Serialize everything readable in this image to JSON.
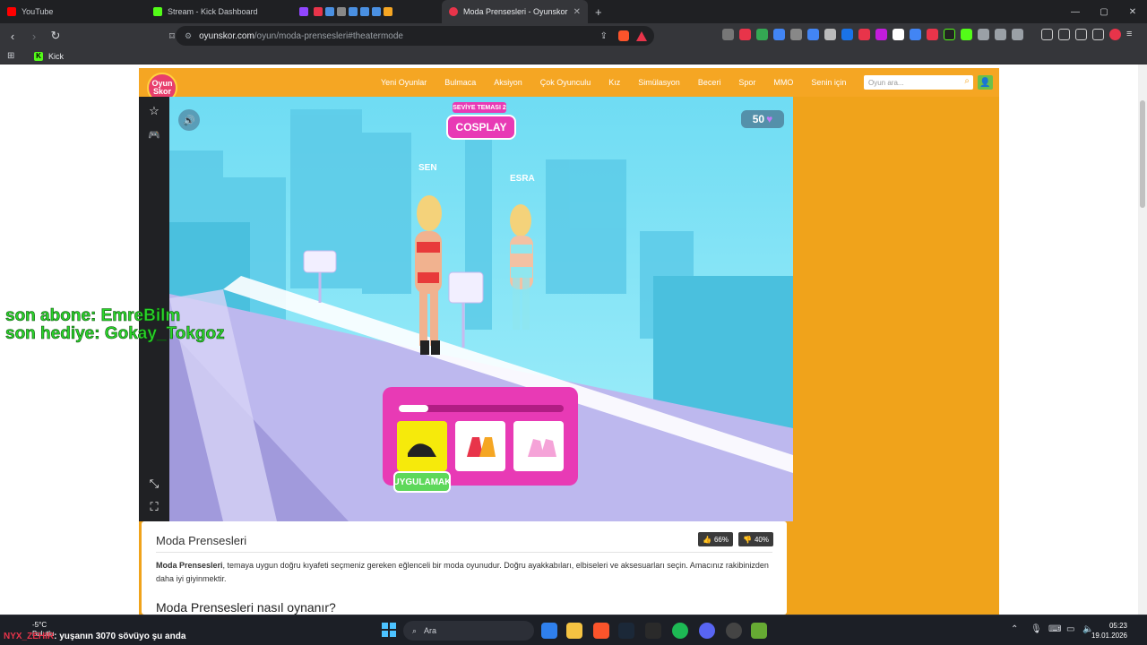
{
  "browser": {
    "tabs": [
      {
        "label": "YouTube",
        "color": "#ff0000"
      },
      {
        "label": "Stream - Kick Dashboard",
        "color": "#53fc18"
      },
      {
        "label": "",
        "color": "#9146ff"
      },
      {
        "label": "Moda Prensesleri - Oyunskor",
        "color": "#e8344a",
        "active": true
      }
    ],
    "new_tab": "+",
    "url_site": "oyunskor.com",
    "url_path": "/oyun/moda-prensesleri#theatermode",
    "bookmark": "Kick",
    "win_min": "—",
    "win_max": "▢",
    "win_close": "✕"
  },
  "site": {
    "logo_line1": "Oyun",
    "logo_line2": "Skor",
    "menu": [
      "Yeni Oyunlar",
      "Bulmaca",
      "Aksiyon",
      "Çok Oyunculu",
      "Kız",
      "Simülasyon",
      "Beceri",
      "Spor",
      "MMO",
      "Senin için"
    ],
    "search_placeholder": "Oyun ara...",
    "search_icon": "⌕",
    "user_icon": "👤"
  },
  "game": {
    "level_label": "SEVİYE TEMASI 2",
    "theme": "COSPLAY",
    "player_label": "SEN",
    "rival_label": "ESRA",
    "gems": "50",
    "gem_icon": "♥",
    "sound_icon": "🔊",
    "apply_button": "UYGULAMAK",
    "progress": 0.18,
    "colors": {
      "pink": "#e83ab5",
      "gold": "#f5a623",
      "green": "#5ed85a",
      "sky": "#7fe7f6"
    }
  },
  "rail": {
    "star_icon": "☆",
    "gamepad_icon": "🎮",
    "shrink_icon": "⤡",
    "fullscreen_icon": "⛶"
  },
  "info": {
    "title": "Moda Prensesleri",
    "likes": "66%",
    "dislikes": "40%",
    "like_icon": "👍",
    "dislike_icon": "👎",
    "desc_bold": "Moda Prensesleri",
    "desc_rest": ", temaya uygun doğru kıyafeti seçmeniz gereken eğlenceli bir moda oyunudur. Doğru ayakkabıları, elbiseleri ve aksesuarları seçin. Amacınız rakibinizden daha iyi giyinmektir.",
    "howto": "Moda Prensesleri nasıl oynanır?"
  },
  "overlay": {
    "line1": "son abone: EmreBilm",
    "line2": "son hediye: Gokay_Tokgoz"
  },
  "taskbar": {
    "search": "Ara",
    "temp": "-5°C",
    "weather": "Bulutlu",
    "time": "05:23",
    "date": "19.01.2026"
  },
  "chat": {
    "nick": "NYX_ZEHIR",
    "message": ": yuşanın 3070 sövüyo şu anda"
  }
}
